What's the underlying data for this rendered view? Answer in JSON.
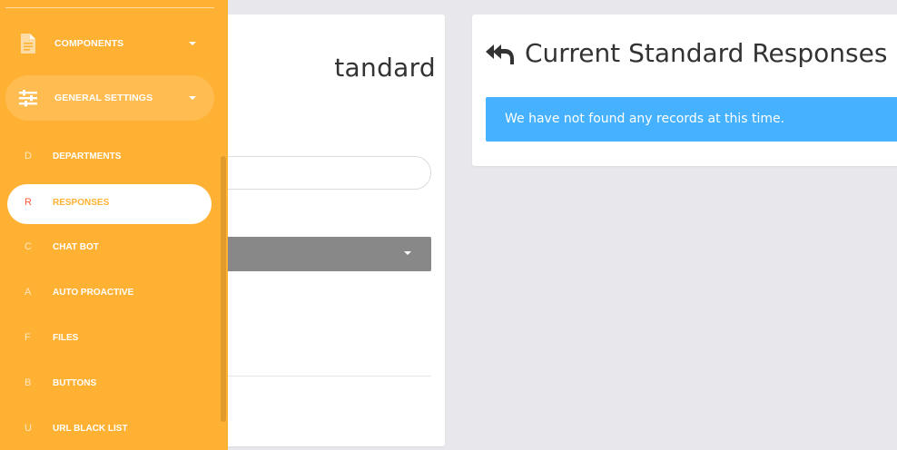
{
  "left_card": {
    "title_fragment": "tandard"
  },
  "right_card": {
    "icon": "reply-all-icon",
    "title": "Current Standard Responses",
    "alert_text": "We have not found any records at this time."
  },
  "sidebar": {
    "accent_color": "#ffb133",
    "sections": [
      {
        "label": "COMPONENTS",
        "icon": "document-icon"
      },
      {
        "label": "GENERAL SETTINGS",
        "icon": "sliders-icon"
      }
    ],
    "items": [
      {
        "letter": "D",
        "label": "DEPARTMENTS"
      },
      {
        "letter": "R",
        "label": "RESPONSES"
      },
      {
        "letter": "C",
        "label": "CHAT BOT"
      },
      {
        "letter": "A",
        "label": "AUTO PROACTIVE"
      },
      {
        "letter": "F",
        "label": "FILES"
      },
      {
        "letter": "B",
        "label": "BUTTONS"
      },
      {
        "letter": "U",
        "label": "URL BLACK LIST"
      }
    ]
  }
}
